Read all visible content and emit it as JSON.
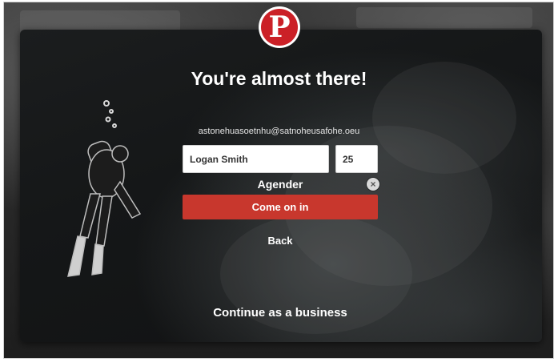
{
  "brand": {
    "logo_letter": "P",
    "logo_color": "#cb2027"
  },
  "signup": {
    "title": "You're almost there!",
    "email": "astonehuasoetnhu@satnoheusafohe.oeu",
    "name_value": "Logan Smith",
    "age_value": "25",
    "gender_value": "Agender",
    "clear_icon": "close-circle-icon",
    "submit_label": "Come on in",
    "submit_color": "#c8372d",
    "back_label": "Back",
    "business_label": "Continue as a business"
  }
}
